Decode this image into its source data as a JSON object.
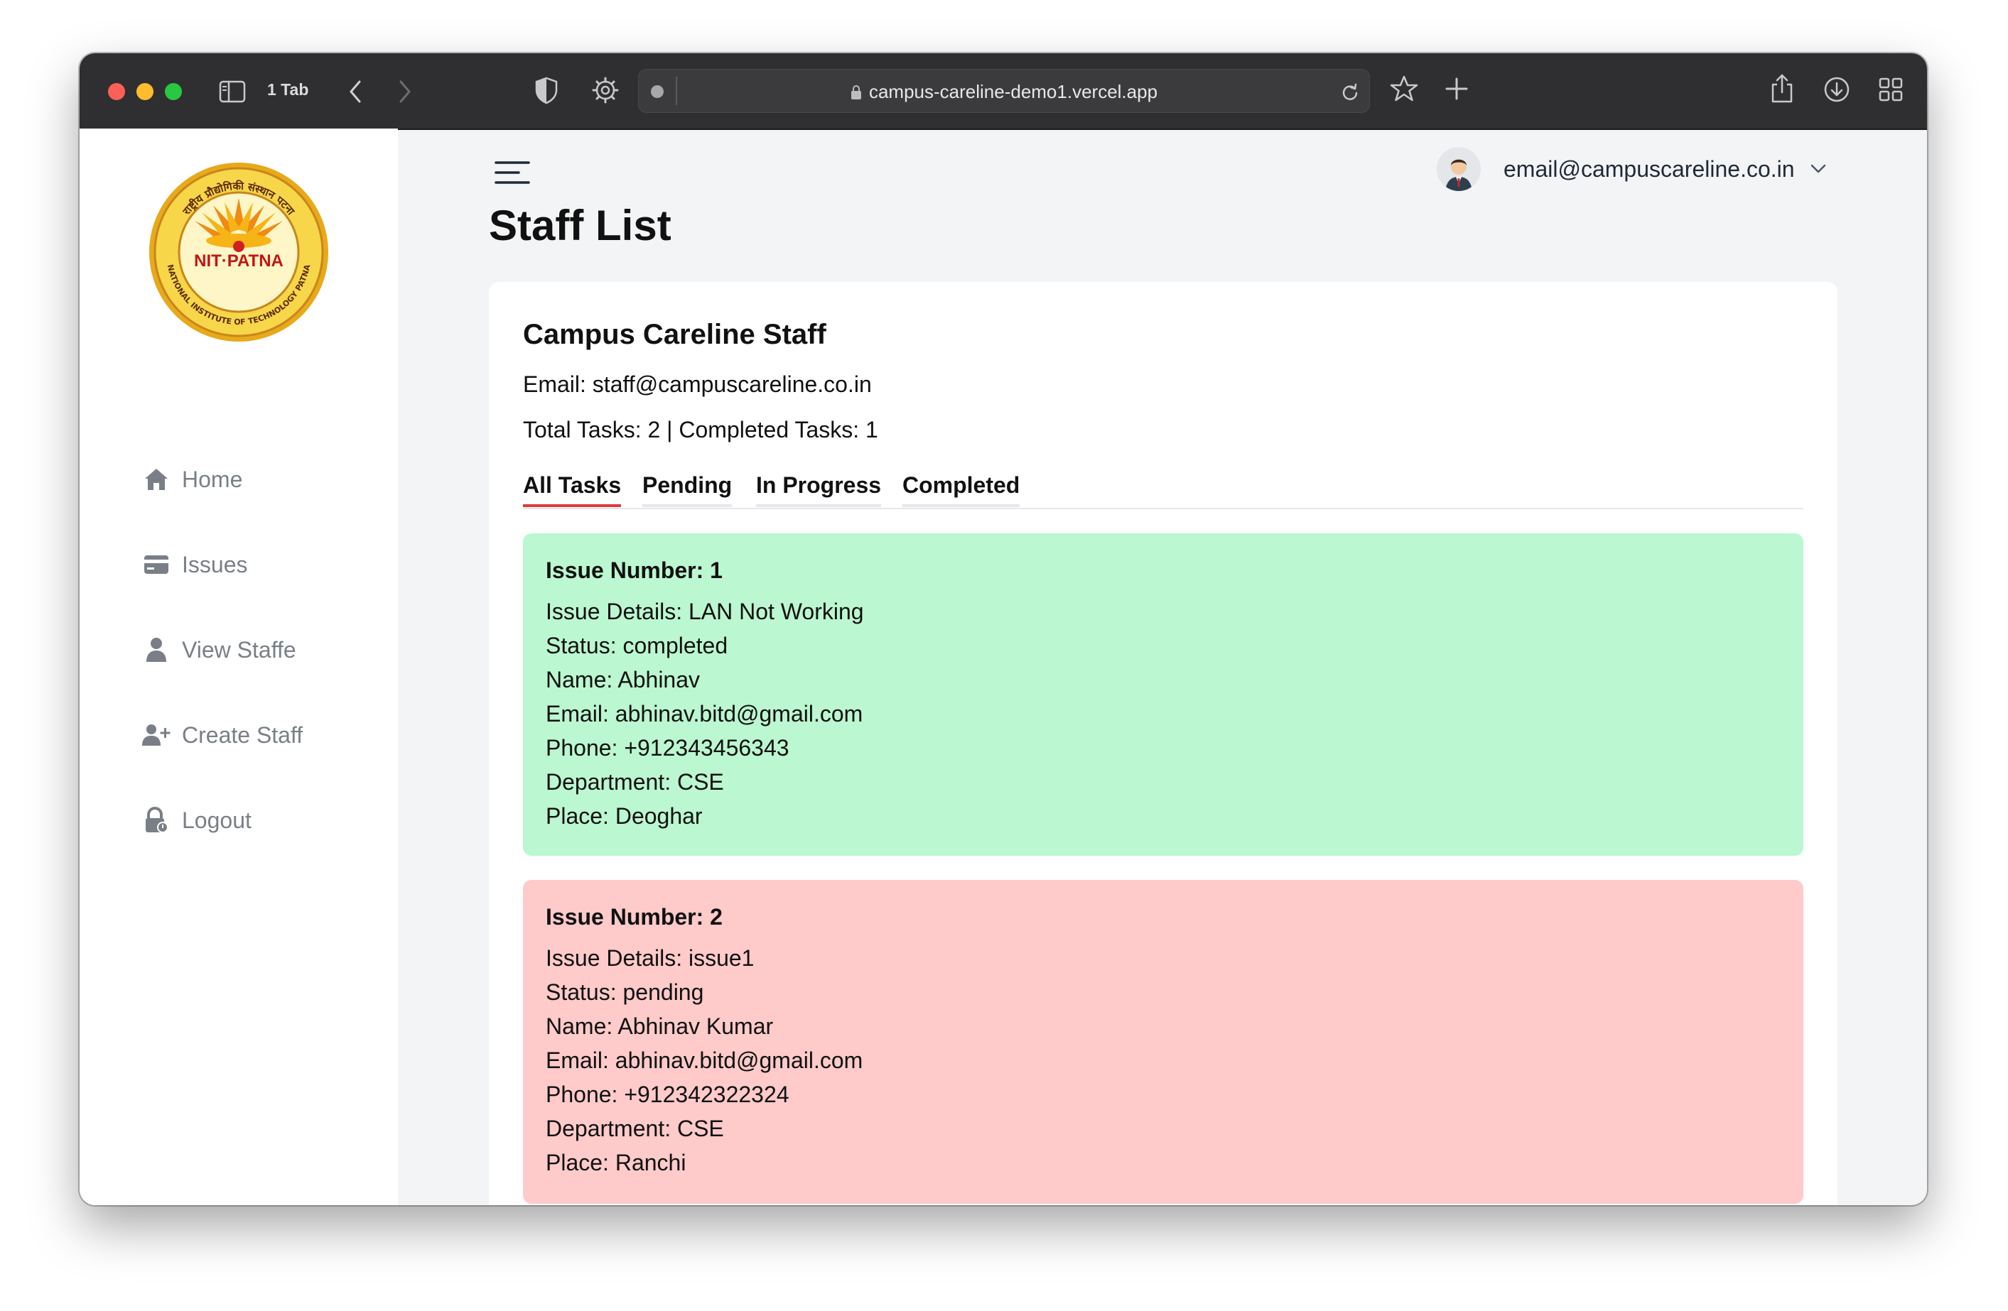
{
  "browser": {
    "tab_count": "1 Tab",
    "url": "campus-careline-demo1.vercel.app"
  },
  "sidebar": {
    "logo": {
      "lines": [
        "राष्ट्रीय प्रौद्योगिकी संस्थान पटना",
        "NIT·PATNA",
        "NATIONAL INSTITUTE OF TECHNOLOGY PATNA"
      ]
    },
    "items": [
      {
        "label": "Home",
        "icon": "home-icon"
      },
      {
        "label": "Issues",
        "icon": "card-icon"
      },
      {
        "label": "View Staffe",
        "icon": "user-icon"
      },
      {
        "label": "Create Staff",
        "icon": "user-plus-icon"
      },
      {
        "label": "Logout",
        "icon": "lock-icon"
      }
    ]
  },
  "header": {
    "user_email": "email@campuscareline.co.in"
  },
  "page_title": "Staff List",
  "staff": {
    "name": "Campus Careline Staff",
    "email": "Email: staff@campuscareline.co.in",
    "summary": "Total Tasks: 2 | Completed Tasks: 1"
  },
  "tabs": [
    {
      "label": "All Tasks",
      "active": true
    },
    {
      "label": "Pending",
      "active": false
    },
    {
      "label": "In Progress",
      "active": false
    },
    {
      "label": "Completed",
      "active": false
    }
  ],
  "issues": [
    {
      "heading": "Issue Number: 1",
      "details": "Issue Details: LAN Not Working",
      "status": "Status: completed",
      "name": "Name: Abhinav",
      "email": "Email: abhinav.bitd@gmail.com",
      "phone": "Phone: +912343456343",
      "department": "Department: CSE",
      "place": "Place: Deoghar",
      "color": "#bbf7d0"
    },
    {
      "heading": "Issue Number: 2",
      "details": "Issue Details: issue1",
      "status": "Status: pending",
      "name": "Name: Abhinav Kumar",
      "email": "Email: abhinav.bitd@gmail.com",
      "phone": "Phone: +912342322324",
      "department": "Department: CSE",
      "place": "Place: Ranchi",
      "color": "#fecaca"
    }
  ],
  "colors": {
    "accent_tab_underline": "#dc3b3b",
    "completed_card": "#bbf7d0",
    "pending_card": "#fecaca"
  }
}
